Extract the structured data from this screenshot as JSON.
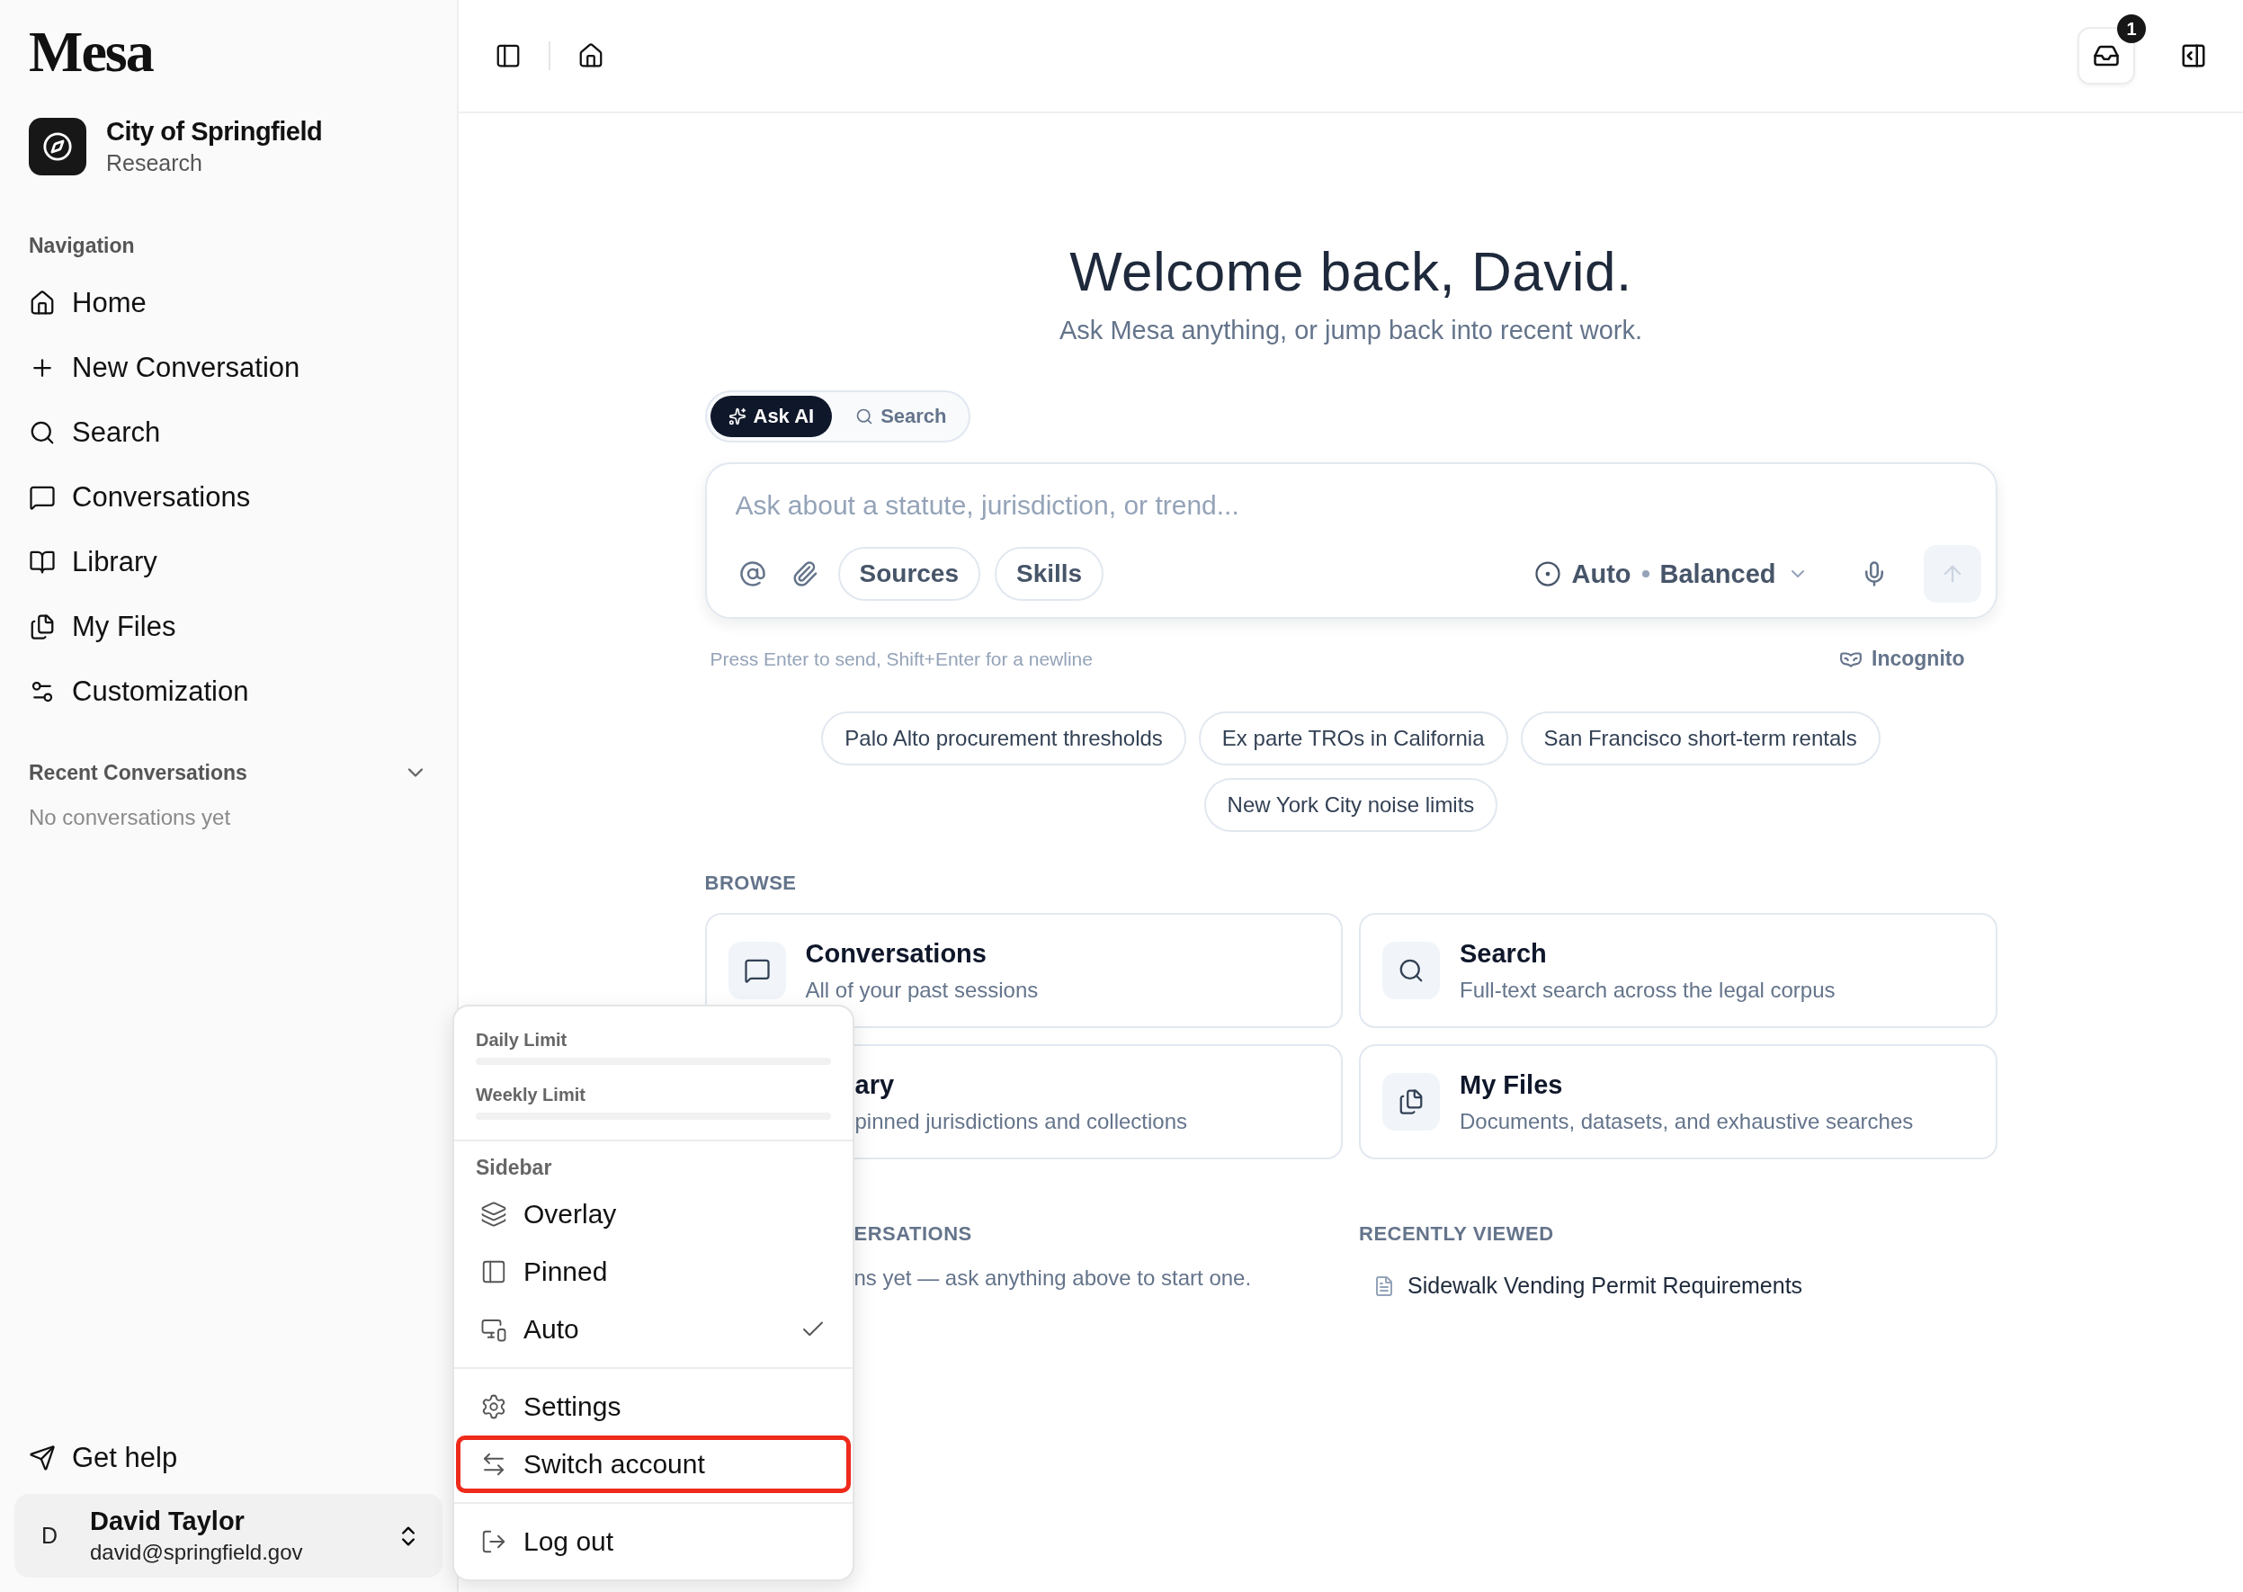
{
  "sidebar": {
    "logo": "Mesa",
    "org": {
      "name": "City of Springfield",
      "subtitle": "Research"
    },
    "nav_heading": "Navigation",
    "nav_items": [
      {
        "label": "Home"
      },
      {
        "label": "New Conversation"
      },
      {
        "label": "Search"
      },
      {
        "label": "Conversations"
      },
      {
        "label": "Library"
      },
      {
        "label": "My Files"
      },
      {
        "label": "Customization"
      }
    ],
    "recent": {
      "heading": "Recent Conversations",
      "expanded": true,
      "empty_text": "No conversations yet"
    },
    "help": "Get help",
    "user": {
      "initial": "D",
      "name": "David Taylor",
      "email": "david@springfield.gov"
    }
  },
  "topbar": {
    "inbox_badge": "1"
  },
  "hero": {
    "title": "Welcome back, David.",
    "subtitle": "Ask Mesa anything, or jump back into recent work."
  },
  "mode_tabs": [
    {
      "label": "Ask AI",
      "selected": true
    },
    {
      "label": "Search",
      "selected": false
    }
  ],
  "composer": {
    "placeholder": "Ask about a statute, jurisdiction, or trend...",
    "chips": [
      "Sources",
      "Skills"
    ],
    "mode": "Auto",
    "model": "Balanced",
    "send_disabled": true,
    "hint": "Press Enter to send, Shift+Enter for a newline",
    "incognito": "Incognito"
  },
  "suggestions": [
    "Palo Alto procurement thresholds",
    "Ex parte TROs in California",
    "San Francisco short-term rentals",
    "New York City noise limits"
  ],
  "browse": {
    "heading": "BROWSE",
    "cards": [
      {
        "title": "Conversations",
        "description": "All of your past sessions",
        "covered": false
      },
      {
        "title": "Search",
        "description": "Full-text search across the legal corpus",
        "covered": false
      },
      {
        "title": "ary",
        "description": "pinned jurisdictions and collections",
        "covered": true
      },
      {
        "title": "My Files",
        "description": "Documents, datasets, and exhaustive searches",
        "covered": false
      }
    ]
  },
  "recent_conversations": {
    "heading": "ERSATIONS",
    "empty_text": "ns yet — ask anything above to start one."
  },
  "recently_viewed": {
    "heading": "RECENTLY VIEWED",
    "items": [
      {
        "title": "Sidewalk Vending Permit Requirements"
      }
    ]
  },
  "menu": {
    "limits": [
      {
        "label": "Daily Limit",
        "level": 0
      },
      {
        "label": "Weekly Limit",
        "level": 0
      }
    ],
    "section": "Sidebar",
    "options": [
      {
        "label": "Overlay",
        "selected": false
      },
      {
        "label": "Pinned",
        "selected": false
      },
      {
        "label": "Auto",
        "selected": true
      }
    ],
    "actions": [
      {
        "label": "Settings",
        "highlighted": false
      },
      {
        "label": "Switch account",
        "highlighted": true
      }
    ],
    "footer_actions": [
      {
        "label": "Log out",
        "highlighted": false
      }
    ]
  }
}
